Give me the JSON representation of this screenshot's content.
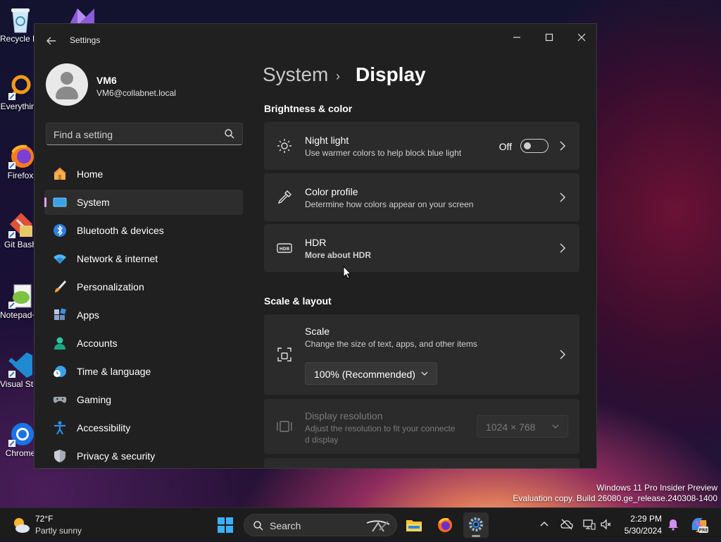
{
  "desktop": {
    "icons": [
      {
        "label": "Recycle Bin",
        "icon": "recycle-bin-icon"
      },
      {
        "label": "Everything",
        "icon": "everything-icon"
      },
      {
        "label": "Firefox",
        "icon": "firefox-icon"
      },
      {
        "label": "Git Bash",
        "icon": "git-bash-icon"
      },
      {
        "label": "Notepad++",
        "icon": "notepad-plus-icon"
      },
      {
        "label": "Visual Studio Code",
        "icon": "vscode-icon"
      },
      {
        "label": "Chrome",
        "icon": "chrome-icon"
      }
    ],
    "watermark": {
      "line1": "Windows 11 Pro Insider Preview",
      "line2": "Evaluation copy. Build 26080.ge_release.240308-1400"
    }
  },
  "window": {
    "title": "Settings",
    "controls": {
      "minimize": "—",
      "maximize": "☐",
      "close": "✕"
    }
  },
  "user": {
    "name": "VM6",
    "email": "VM6@collabnet.local"
  },
  "search": {
    "placeholder": "Find a setting"
  },
  "nav": {
    "items": [
      {
        "label": "Home",
        "icon": "home-icon"
      },
      {
        "label": "System",
        "icon": "system-icon",
        "active": true
      },
      {
        "label": "Bluetooth & devices",
        "icon": "bluetooth-icon"
      },
      {
        "label": "Network & internet",
        "icon": "wifi-icon"
      },
      {
        "label": "Personalization",
        "icon": "brush-icon"
      },
      {
        "label": "Apps",
        "icon": "apps-icon"
      },
      {
        "label": "Accounts",
        "icon": "accounts-icon"
      },
      {
        "label": "Time & language",
        "icon": "globe-clock-icon"
      },
      {
        "label": "Gaming",
        "icon": "gamepad-icon"
      },
      {
        "label": "Accessibility",
        "icon": "accessibility-icon"
      },
      {
        "label": "Privacy & security",
        "icon": "shield-icon"
      }
    ]
  },
  "breadcrumb": {
    "parent": "System",
    "separator": "›",
    "current": "Display"
  },
  "sections": {
    "brightness": "Brightness & color",
    "scale_layout": "Scale & layout"
  },
  "cards": {
    "night_light": {
      "title": "Night light",
      "subtitle": "Use warmer colors to help block blue light",
      "state": "Off",
      "on": false
    },
    "color_profile": {
      "title": "Color profile",
      "subtitle": "Determine how colors appear on your screen"
    },
    "hdr": {
      "title": "HDR",
      "subtitle": "More about HDR"
    },
    "scale": {
      "title": "Scale",
      "subtitle": "Change the size of text, apps, and other items",
      "value": "100% (Recommended)"
    },
    "resolution": {
      "title": "Display resolution",
      "subtitle_line1": "Adjust the resolution to fit your connecte",
      "subtitle_line2": "d display",
      "value": "1024 × 768",
      "disabled": true
    }
  },
  "taskbar": {
    "weather": {
      "temp": "72°F",
      "condition": "Partly sunny"
    },
    "search_label": "Search",
    "clock": {
      "time": "2:29 PM",
      "date": "5/30/2024"
    }
  },
  "colors": {
    "accent": "#e6a0ff",
    "window_bg": "#202020",
    "card_bg": "#2b2b2b",
    "taskbar_bg": "#1c1c1c"
  }
}
